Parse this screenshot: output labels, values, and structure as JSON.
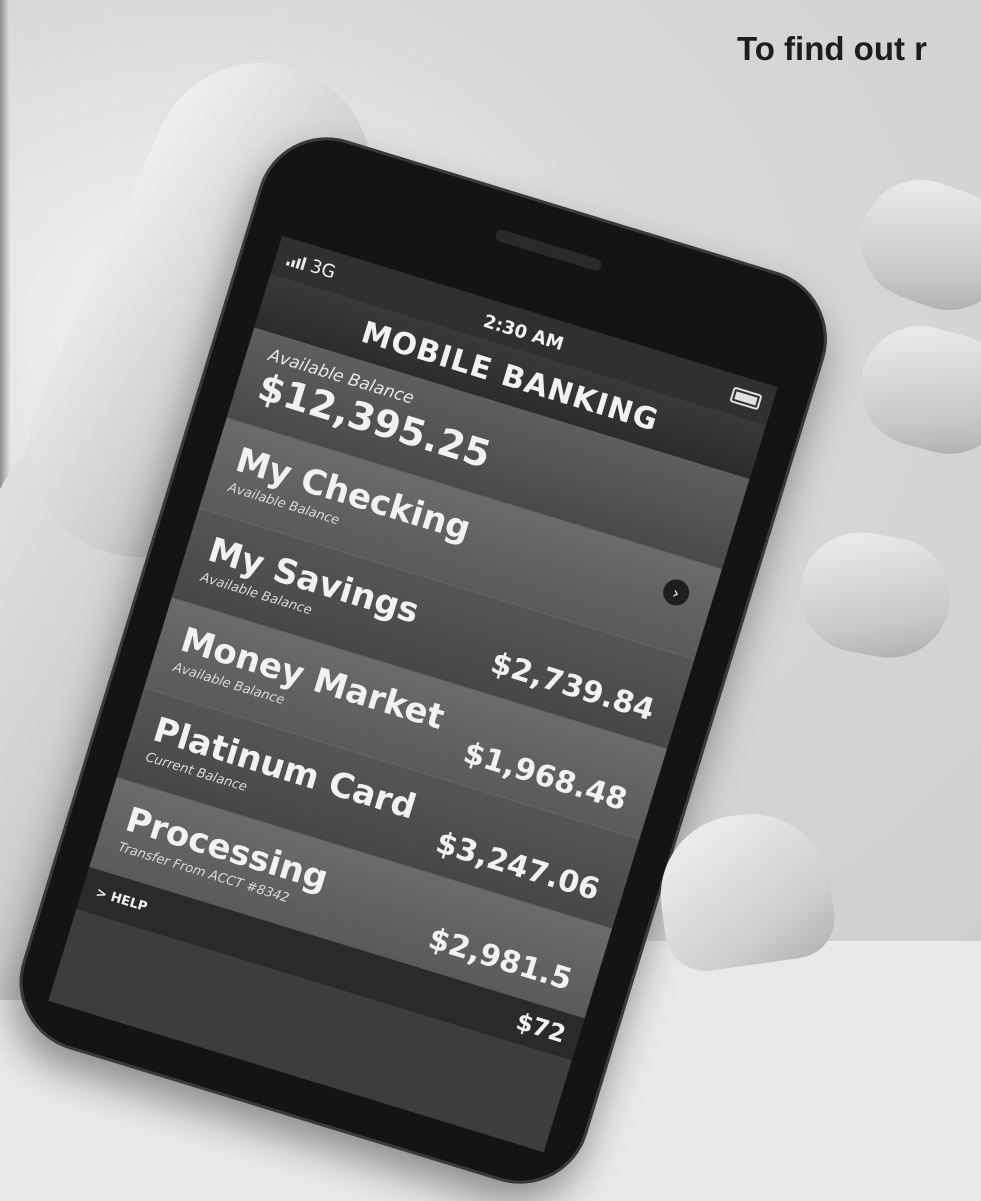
{
  "headline": "To find out r",
  "phone": {
    "status": {
      "network": "3G",
      "time": "2:30 AM"
    },
    "app_title": "MOBILE BANKING",
    "balance": {
      "label": "Available Balance",
      "value": "$12,395.25"
    },
    "accounts": [
      {
        "name": "My Checking",
        "sub": "Available Balance",
        "amount": ""
      },
      {
        "name": "My Savings",
        "sub": "Available Balance",
        "amount": "$2,739.84"
      },
      {
        "name": "Money Market",
        "sub": "Available Balance",
        "amount": "$1,968.48"
      },
      {
        "name": "Platinum Card",
        "sub": "Current Balance",
        "amount": "$3,247.06"
      },
      {
        "name": "Processing",
        "sub": "Transfer From ACCT #8342",
        "amount": "$2,981.5"
      }
    ],
    "partial_amount": "$72",
    "help_label": "> HELP"
  },
  "icons": {
    "signal": "signal-bars-icon",
    "battery": "battery-icon",
    "chevron": "chevron-right-icon"
  },
  "colors": {
    "screen_bg": "#3d3d3d",
    "headline": "#1d1d1d"
  }
}
